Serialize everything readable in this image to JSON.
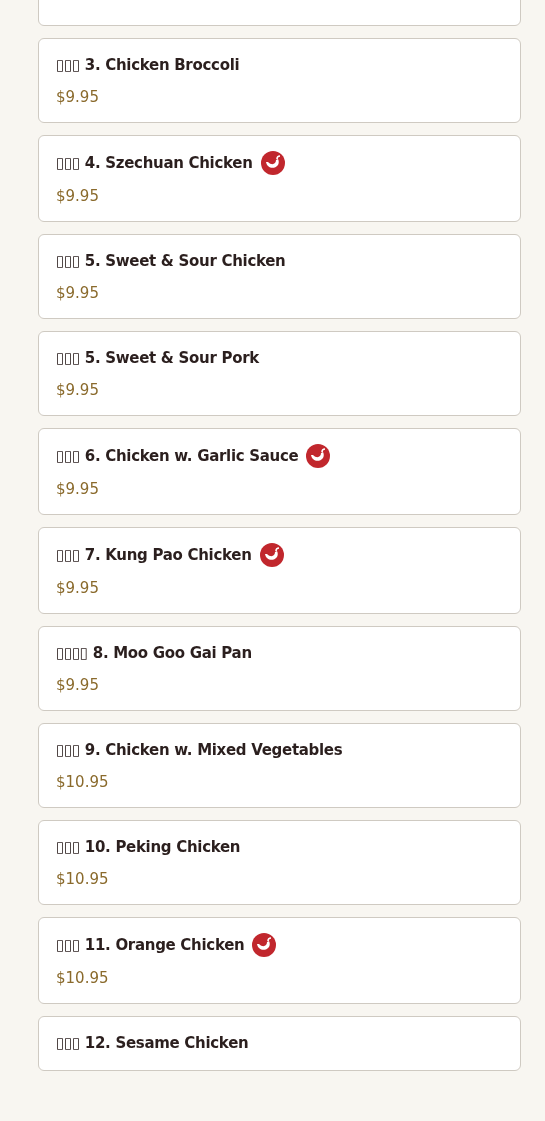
{
  "items": [
    {
      "name": "▯▯▯ 3. Chicken Broccoli",
      "price": "$9.95",
      "spicy": false
    },
    {
      "name": "▯▯▯ 4. Szechuan Chicken",
      "price": "$9.95",
      "spicy": true
    },
    {
      "name": "▯▯▯ 5. Sweet & Sour Chicken",
      "price": "$9.95",
      "spicy": false
    },
    {
      "name": "▯▯▯ 5. Sweet & Sour Pork",
      "price": "$9.95",
      "spicy": false
    },
    {
      "name": "▯▯▯ 6. Chicken w. Garlic Sauce",
      "price": "$9.95",
      "spicy": true
    },
    {
      "name": "▯▯▯ 7. Kung Pao Chicken",
      "price": "$9.95",
      "spicy": true
    },
    {
      "name": "▯▯▯▯ 8. Moo Goo Gai Pan",
      "price": "$9.95",
      "spicy": false
    },
    {
      "name": "▯▯▯ 9. Chicken w. Mixed Vegetables",
      "price": "$10.95",
      "spicy": false
    },
    {
      "name": "▯▯▯ 10. Peking Chicken",
      "price": "$10.95",
      "spicy": false
    },
    {
      "name": "▯▯▯ 11. Orange Chicken",
      "price": "$10.95",
      "spicy": true
    },
    {
      "name": "▯▯▯ 12. Sesame Chicken",
      "spicy": false
    }
  ]
}
